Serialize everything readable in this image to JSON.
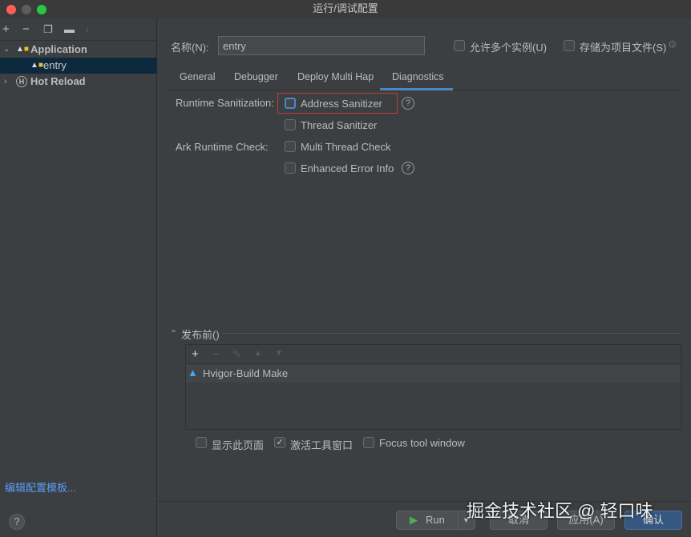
{
  "window": {
    "title": "运行/调试配置"
  },
  "sidebar": {
    "tree": [
      {
        "label": "Application",
        "expanded": true,
        "children": [
          {
            "label": "entry",
            "selected": true
          }
        ]
      },
      {
        "label": "Hot Reload",
        "expanded": false
      }
    ],
    "footer_link": "编辑配置模板..."
  },
  "form": {
    "name_label": "名称(N):",
    "name_value": "entry",
    "allow_multiple": "允许多个实例(U)",
    "store_as_file": "存储为项目文件(S)"
  },
  "tabs": [
    {
      "label": "General"
    },
    {
      "label": "Debugger"
    },
    {
      "label": "Deploy Multi Hap"
    },
    {
      "label": "Diagnostics",
      "active": true
    }
  ],
  "diagnostics": {
    "runtime_label": "Runtime Sanitization:",
    "address": "Address Sanitizer",
    "thread": "Thread Sanitizer",
    "ark_label": "Ark Runtime Check:",
    "multi_thread": "Multi Thread Check",
    "enhanced": "Enhanced Error Info"
  },
  "before_launch": {
    "title": "发布前()",
    "tasks": [
      "Hvigor-Build Make"
    ],
    "show_page": "显示此页面",
    "activate_tool": "激活工具窗口",
    "activate_checked": true,
    "focus_tool": "Focus tool window"
  },
  "buttons": {
    "run": "Run",
    "cancel": "取消",
    "apply": "应用(A)",
    "ok": "确认"
  },
  "watermark": "掘金技术社区 @ 轻口味",
  "colors": {
    "accent": "#4a88c7",
    "selection": "#0d293e",
    "highlight_box": "#c23b3b"
  }
}
